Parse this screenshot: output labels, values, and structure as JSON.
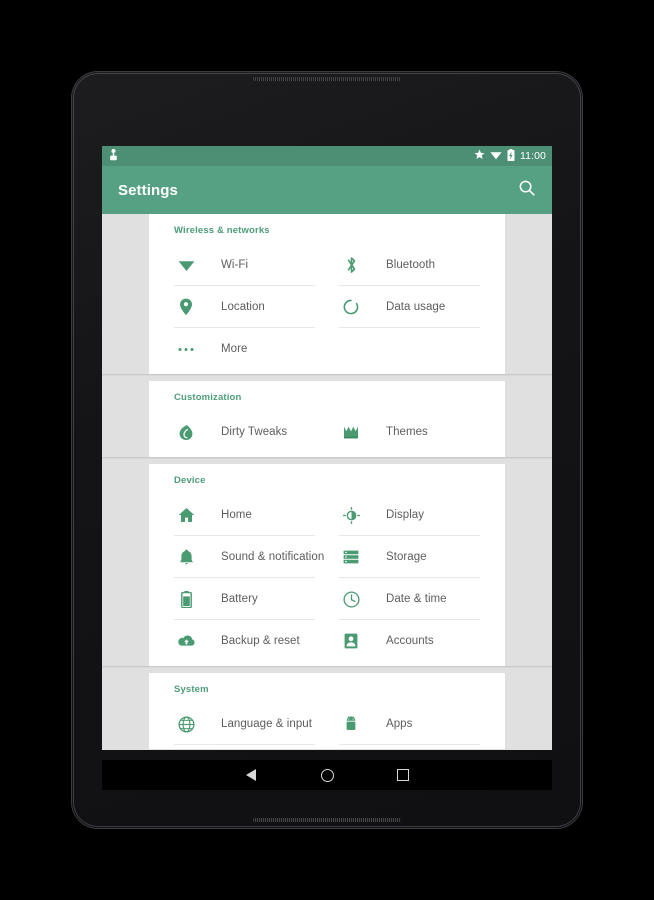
{
  "app": {
    "title": "Settings",
    "accent_green": "#56a183",
    "status_green": "#4d8f74",
    "icon_green": "#4a9a72",
    "section_title_color": "#4e9d7b",
    "label_color": "#5d5d5d",
    "card_bg": "#ffffff",
    "page_bg": "#e0e0e0"
  },
  "status_bar": {
    "left_icons": [
      "usb-debug-icon"
    ],
    "right_icons": [
      "star-icon",
      "wifi-icon",
      "battery-charging-icon"
    ],
    "clock": "11:00"
  },
  "toolbar": {
    "title": "Settings",
    "search_label": "Search",
    "search_icon": "search-icon"
  },
  "sections": [
    {
      "title": "Wireless & networks",
      "items": [
        {
          "label": "Wi-Fi",
          "icon": "wifi-icon"
        },
        {
          "label": "Bluetooth",
          "icon": "bluetooth-icon"
        },
        {
          "label": "Location",
          "icon": "location-pin-icon"
        },
        {
          "label": "Data usage",
          "icon": "data-usage-icon"
        },
        {
          "label": "More",
          "icon": "more-dots-icon"
        }
      ]
    },
    {
      "title": "Customization",
      "items": [
        {
          "label": "Dirty Tweaks",
          "icon": "droplet-icon"
        },
        {
          "label": "Themes",
          "icon": "crown-icon"
        }
      ]
    },
    {
      "title": "Device",
      "items": [
        {
          "label": "Home",
          "icon": "home-icon"
        },
        {
          "label": "Display",
          "icon": "brightness-icon"
        },
        {
          "label": "Sound & notification",
          "icon": "bell-icon"
        },
        {
          "label": "Storage",
          "icon": "storage-icon"
        },
        {
          "label": "Battery",
          "icon": "battery-icon"
        },
        {
          "label": "Date & time",
          "icon": "clock-icon"
        },
        {
          "label": "Backup & reset",
          "icon": "cloud-upload-icon"
        },
        {
          "label": "Accounts",
          "icon": "person-card-icon"
        }
      ]
    },
    {
      "title": "System",
      "items": [
        {
          "label": "Language & input",
          "icon": "globe-icon"
        },
        {
          "label": "Apps",
          "icon": "android-icon"
        }
      ]
    }
  ],
  "nav_bar": {
    "back_label": "Back",
    "home_label": "Home",
    "recents_label": "Recents"
  }
}
